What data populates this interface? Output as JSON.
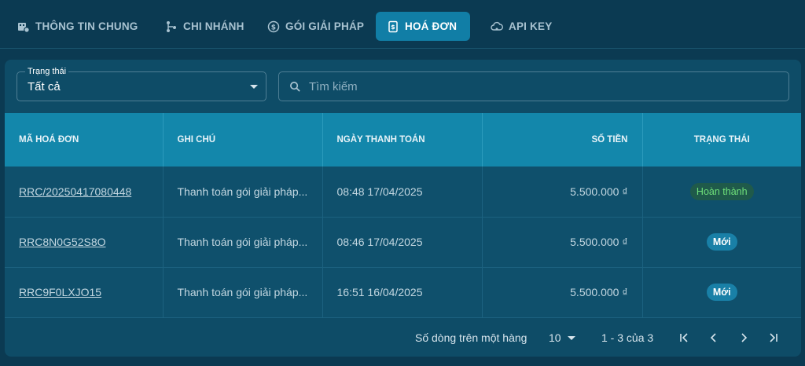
{
  "tabs": [
    {
      "label": "THÔNG TIN CHUNG",
      "icon": "building-gear-icon"
    },
    {
      "label": "CHI NHÁNH",
      "icon": "branch-icon"
    },
    {
      "label": "GÓI GIẢI PHÁP",
      "icon": "dollar-cycle-icon"
    },
    {
      "label": "HOÁ ĐƠN",
      "icon": "invoice-icon",
      "active": true
    },
    {
      "label": "API KEY",
      "icon": "cloud-key-icon"
    }
  ],
  "filter": {
    "label": "Trạng thái",
    "value": "Tất cả"
  },
  "search": {
    "placeholder": "Tìm kiếm"
  },
  "table": {
    "headers": [
      "MÃ HOÁ ĐƠN",
      "GHI CHÚ",
      "NGÀY THANH TOÁN",
      "SỐ TIỀN",
      "TRẠNG THÁI"
    ],
    "rows": [
      {
        "id": "RRC/20250417080448",
        "note": "Thanh toán gói giải pháp...",
        "date": "08:48 17/04/2025",
        "amount": "5.500.000 ₫",
        "status": "Hoàn thành"
      },
      {
        "id": "RRC8N0G52S8O",
        "note": "Thanh toán gói giải pháp...",
        "date": "08:46 17/04/2025",
        "amount": "5.500.000 ₫",
        "status": "Mới"
      },
      {
        "id": "RRC9F0LXJO15",
        "note": "Thanh toán gói giải pháp...",
        "date": "16:51 16/04/2025",
        "amount": "5.500.000 ₫",
        "status": "Mới"
      }
    ]
  },
  "pagination": {
    "rows_per_page_label": "Số dòng trên một hàng",
    "rows_per_page": "10",
    "range": "1 - 3 của 3"
  },
  "colors": {
    "background": "#0b3a52",
    "card": "#0e4c67",
    "accent": "#117ea6",
    "header": "#1387ab",
    "status_done": "#6fe07a",
    "status_new": "#1980a7"
  }
}
